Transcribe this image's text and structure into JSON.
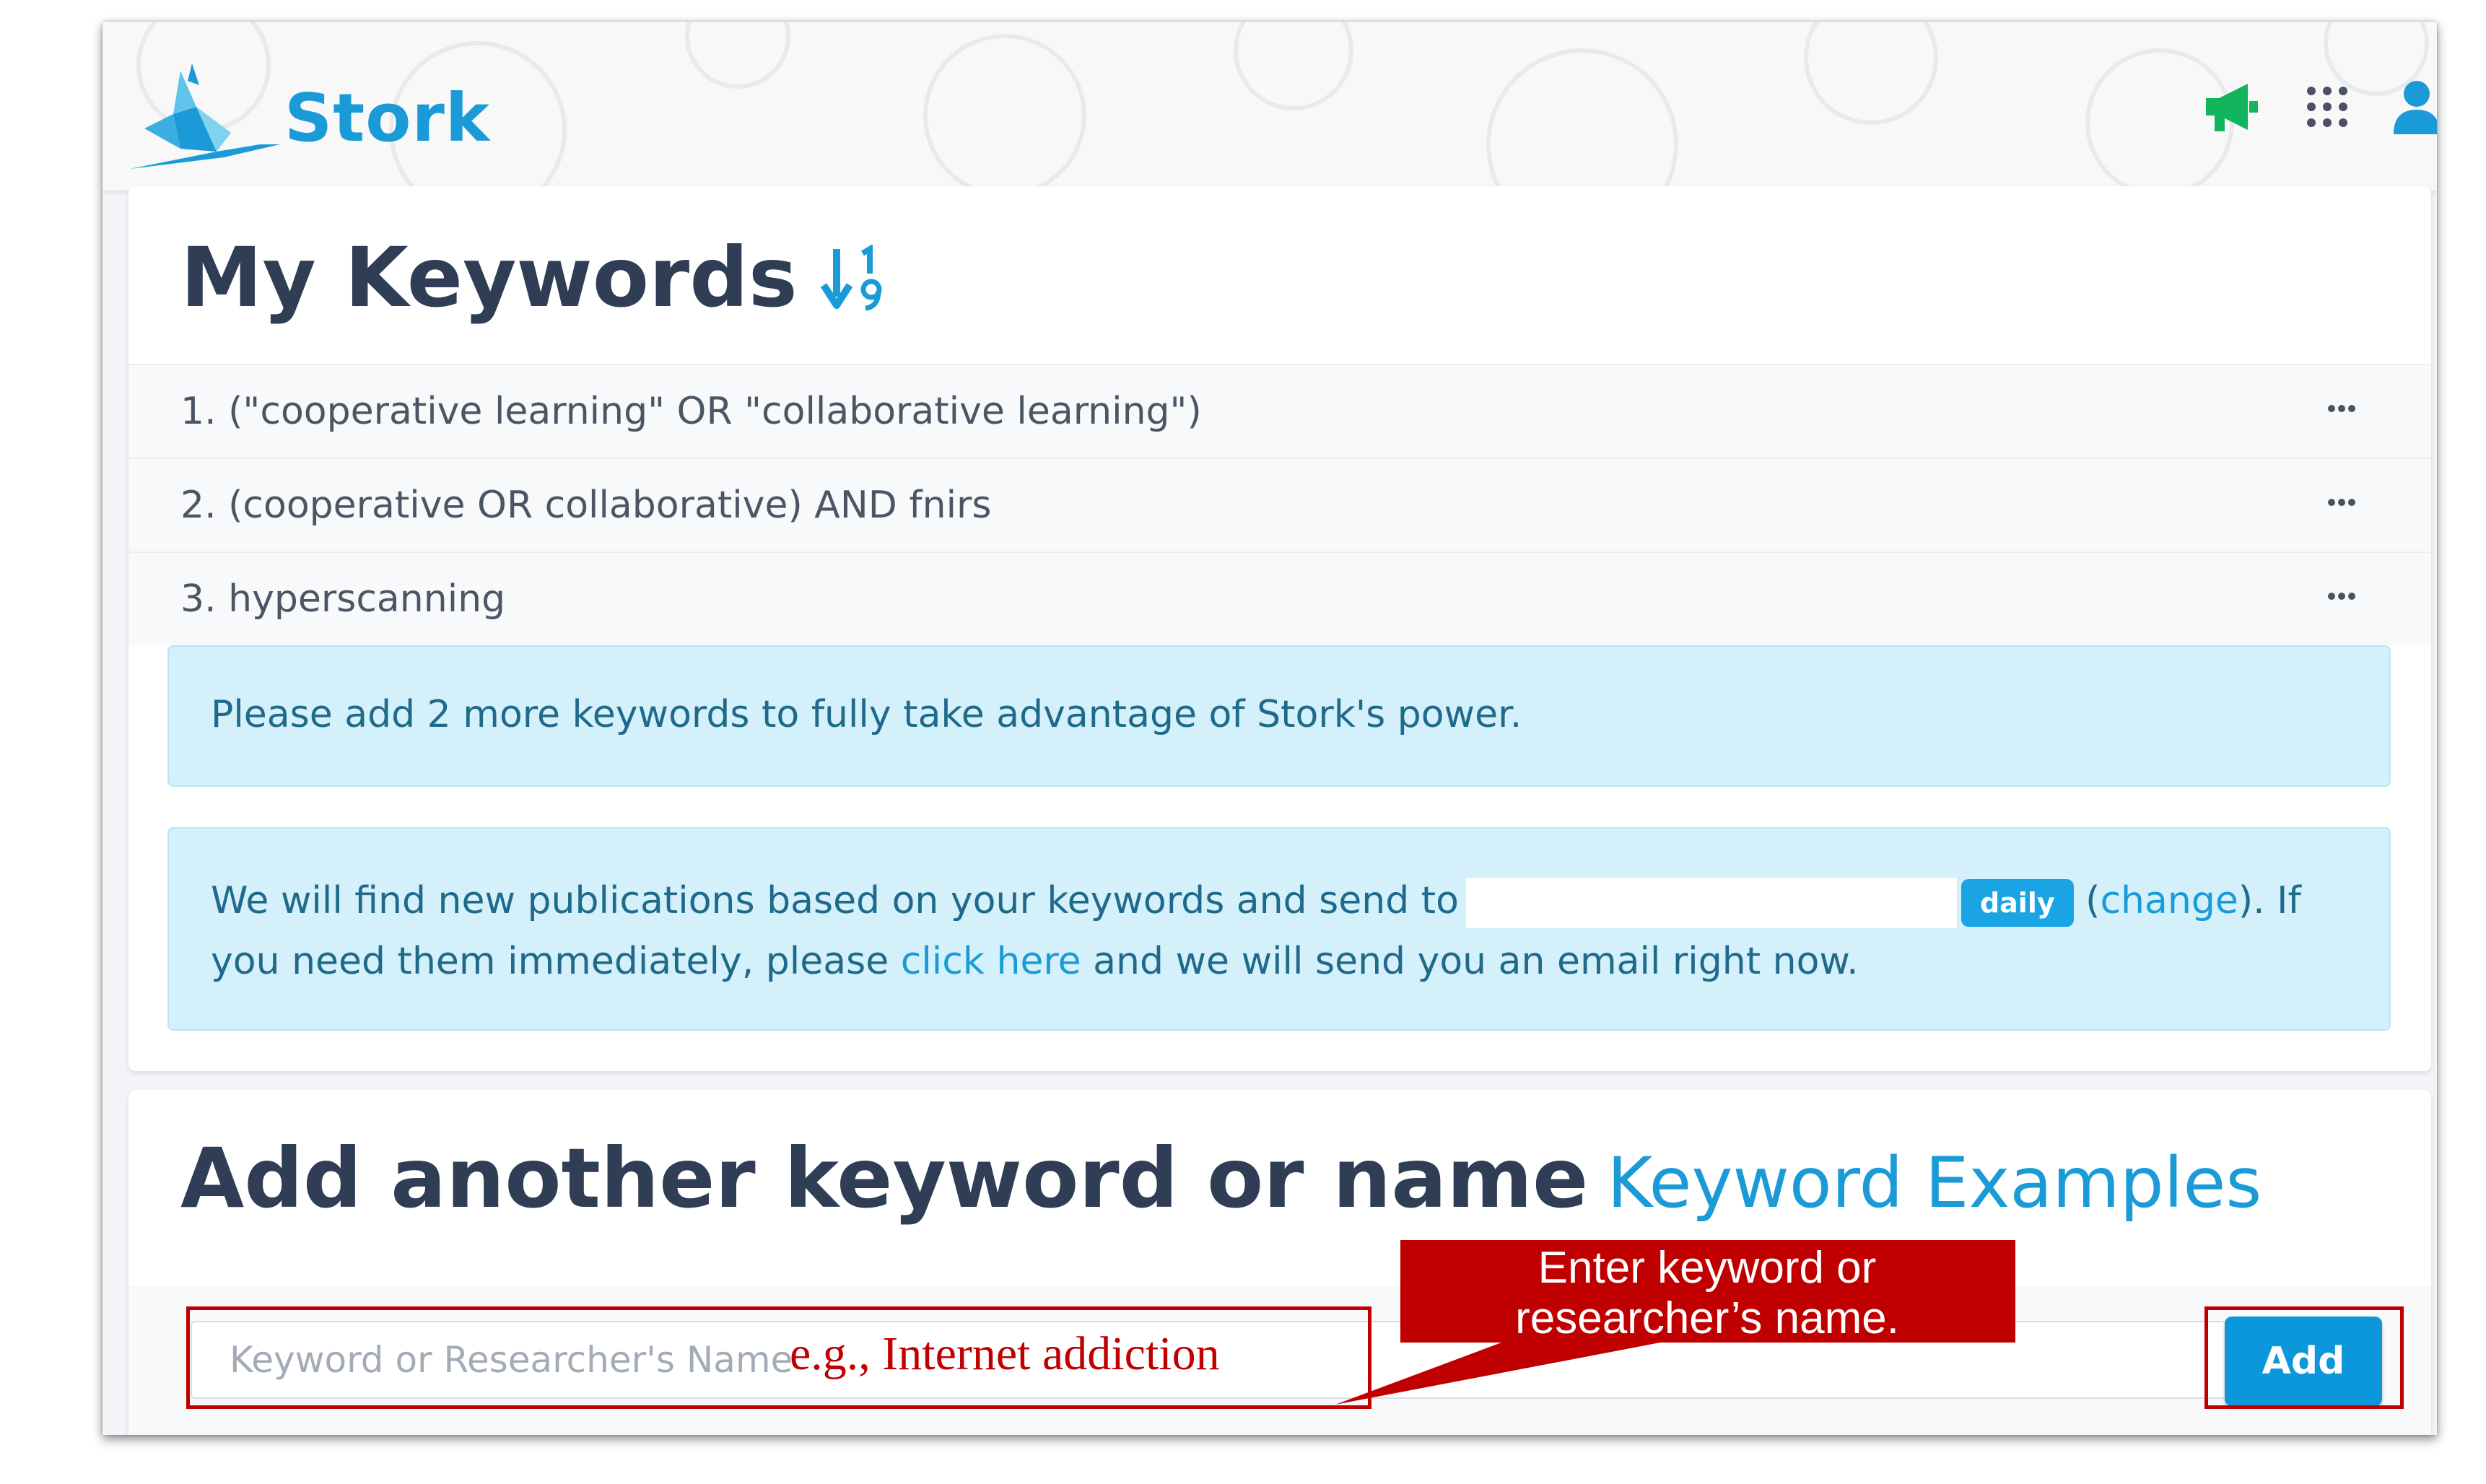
{
  "app": {
    "name": "Stork"
  },
  "header": {
    "icons": [
      "stork-logo-icon",
      "megaphone-icon",
      "apps-grid-icon",
      "user-icon"
    ],
    "colors": {
      "brand": "#1a9bd7",
      "megaphone": "#13b55c"
    }
  },
  "keywords_card": {
    "title": "My Keywords",
    "sort_icon": "sort-numeric-icon",
    "items": [
      {
        "label": "1. (\"cooperative learning\" OR \"collaborative learning\")"
      },
      {
        "label": "2. (cooperative OR collaborative) AND fnirs"
      },
      {
        "label": "3. hyperscanning"
      }
    ],
    "more_icon": "more-dots-icon",
    "notice": "Please add 2 more keywords to fully take advantage of Stork's power.",
    "email_notice": {
      "part1": "We will find new publications based on your keywords and send to",
      "frequency_badge": "daily",
      "paren_open": "(",
      "change_link": "change",
      "part2": "). If you need them immediately, please",
      "click_here_link": "click here",
      "part3": "and we will send you an email right now."
    }
  },
  "add_card": {
    "title": "Add another keyword or name",
    "examples_link": "Keyword Examples",
    "input_placeholder": "Keyword or Researcher's Name",
    "add_button": "Add"
  },
  "annotation": {
    "example_text": "e.g., Internet addiction",
    "callout_line1": "Enter keyword or",
    "callout_line2": "researcher’s name.",
    "color": "#c00000"
  }
}
